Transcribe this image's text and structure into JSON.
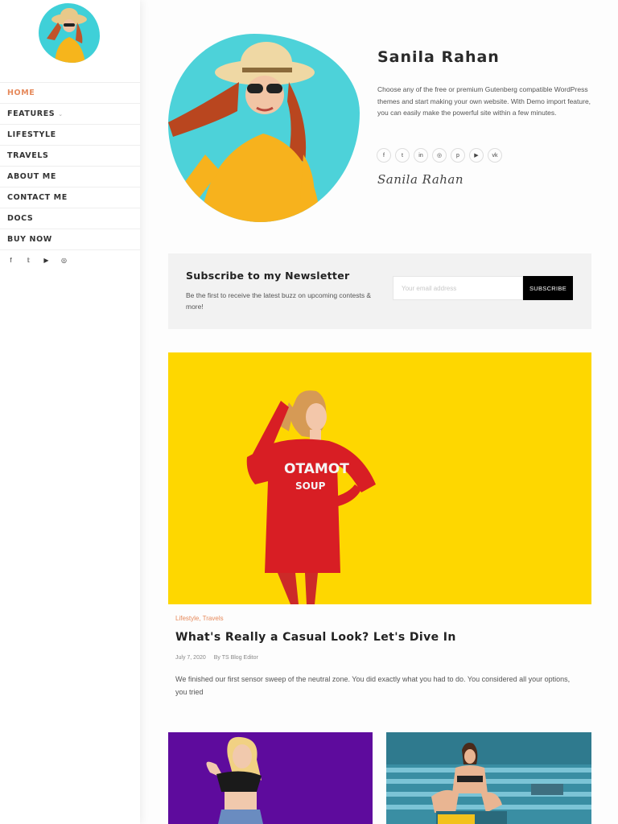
{
  "sidebar": {
    "nav": [
      {
        "label": "HOME",
        "active": true
      },
      {
        "label": "FEATURES",
        "has_dropdown": true,
        "chevron": "⌄"
      },
      {
        "label": "LIFESTYLE"
      },
      {
        "label": "TRAVELS"
      },
      {
        "label": "ABOUT ME"
      },
      {
        "label": "CONTACT ME"
      },
      {
        "label": "DOCS"
      },
      {
        "label": "BUY NOW"
      }
    ],
    "social": [
      "facebook-icon",
      "twitter-icon",
      "youtube-icon",
      "instagram-icon"
    ],
    "social_glyphs": [
      "f",
      "𝕥",
      "▶",
      "◎"
    ]
  },
  "profile": {
    "name": "Sanila Rahan",
    "bio": "Choose any of the free or premium Gutenberg compatible WordPress themes and start making your own website. With Demo import feature, you can easily make the powerful site within a few minutes.",
    "social": [
      "facebook-icon",
      "twitter-icon",
      "linkedin-icon",
      "instagram-icon",
      "pinterest-icon",
      "youtube-icon",
      "vk-icon"
    ],
    "social_glyphs": [
      "f",
      "t",
      "in",
      "◎",
      "p",
      "▶",
      "vk"
    ],
    "signature": "Sanila Rahan"
  },
  "newsletter": {
    "title": "Subscribe to my Newsletter",
    "description": "Be the first to receive the latest buzz on upcoming contests & more!",
    "email_placeholder": "Your email address",
    "button_label": "SUBSCRIBE"
  },
  "featured_post": {
    "categories": [
      "Lifestyle",
      "Travels"
    ],
    "category_separator": ",",
    "title": "What's Really a Casual Look? Let's Dive In",
    "date": "July 7, 2020",
    "author": "By TS Blog Editor",
    "excerpt": "We finished our first sensor sweep of the neutral zone. You did exactly what you had to do. You considered all your options, you tried",
    "sweater_text_line1": "OTAMOT",
    "sweater_text_line2": "SOUP"
  },
  "colors": {
    "accent": "#e68a5c",
    "hero_blob": "#4dd2d9",
    "featured_bg": "#fed700",
    "card_purple": "#5e0b9d",
    "card_pool": "#3a8ea3"
  }
}
